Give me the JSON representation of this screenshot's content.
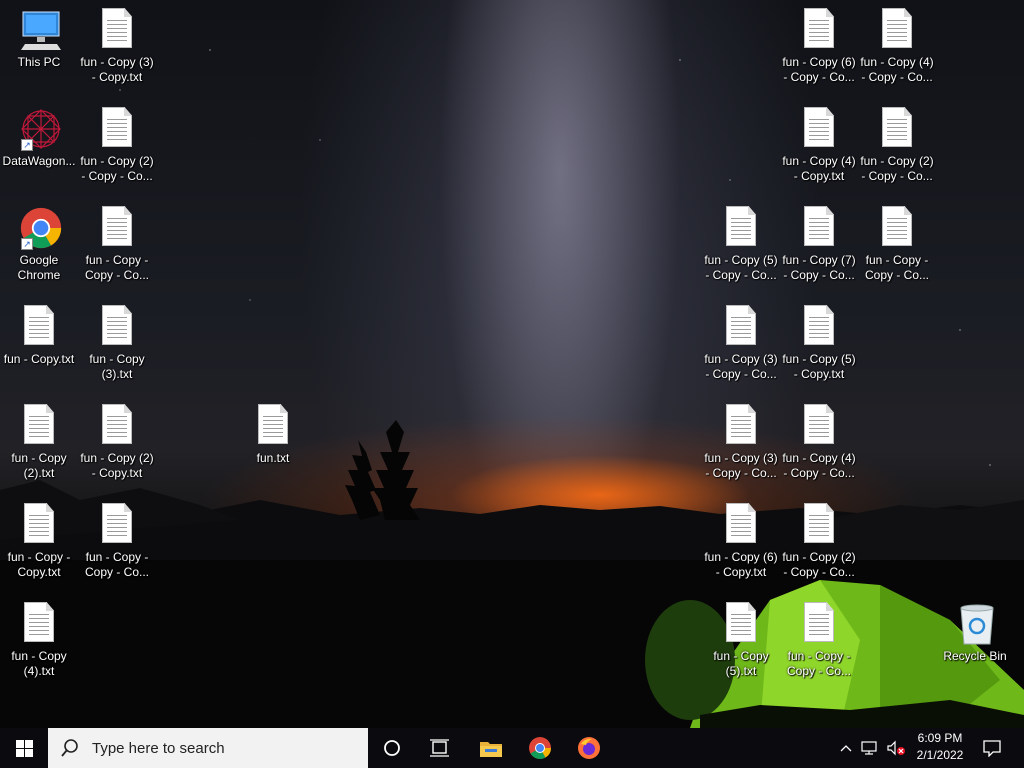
{
  "desktop": {
    "icons": [
      {
        "label": "This PC",
        "type": "pc"
      },
      {
        "label": "fun - Copy (3) - Copy.txt",
        "type": "txt"
      },
      {
        "label": "fun - Copy (6) - Copy - Co...",
        "type": "txt"
      },
      {
        "label": "fun - Copy (4) - Copy - Co...",
        "type": "txt"
      },
      {
        "label": "DataWagon...",
        "type": "app"
      },
      {
        "label": "fun - Copy (2) - Copy - Co...",
        "type": "txt"
      },
      {
        "label": "fun - Copy (4) - Copy.txt",
        "type": "txt"
      },
      {
        "label": "fun - Copy (2) - Copy - Co...",
        "type": "txt"
      },
      {
        "label": "Google Chrome",
        "type": "chrome"
      },
      {
        "label": "fun - Copy - Copy - Co...",
        "type": "txt"
      },
      {
        "label": "fun - Copy (5) - Copy - Co...",
        "type": "txt"
      },
      {
        "label": "fun - Copy (7) - Copy - Co...",
        "type": "txt"
      },
      {
        "label": "fun - Copy - Copy - Co...",
        "type": "txt"
      },
      {
        "label": "fun - Copy.txt",
        "type": "txt"
      },
      {
        "label": "fun - Copy (3).txt",
        "type": "txt"
      },
      {
        "label": "fun - Copy (3) - Copy - Co...",
        "type": "txt"
      },
      {
        "label": "fun - Copy (5) - Copy.txt",
        "type": "txt"
      },
      {
        "label": "fun - Copy (2).txt",
        "type": "txt"
      },
      {
        "label": "fun - Copy (2) - Copy.txt",
        "type": "txt"
      },
      {
        "label": "fun.txt",
        "type": "txt"
      },
      {
        "label": "fun - Copy (3) - Copy - Co...",
        "type": "txt"
      },
      {
        "label": "fun - Copy (4) - Copy - Co...",
        "type": "txt"
      },
      {
        "label": "fun - Copy - Copy.txt",
        "type": "txt"
      },
      {
        "label": "fun - Copy - Copy - Co...",
        "type": "txt"
      },
      {
        "label": "fun - Copy (6) - Copy.txt",
        "type": "txt"
      },
      {
        "label": "fun - Copy (2) - Copy - Co...",
        "type": "txt"
      },
      {
        "label": "fun - Copy (4).txt",
        "type": "txt"
      },
      {
        "label": "fun - Copy (5).txt",
        "type": "txt"
      },
      {
        "label": "fun - Copy - Copy - Co...",
        "type": "txt"
      },
      {
        "label": "Recycle Bin",
        "type": "recycle"
      }
    ]
  },
  "taskbar": {
    "search_placeholder": "Type here to search",
    "clock_time": "6:09 PM",
    "clock_date": "2/1/2022",
    "pinned": [
      "file-explorer-icon",
      "chrome-icon",
      "firefox-icon"
    ]
  }
}
